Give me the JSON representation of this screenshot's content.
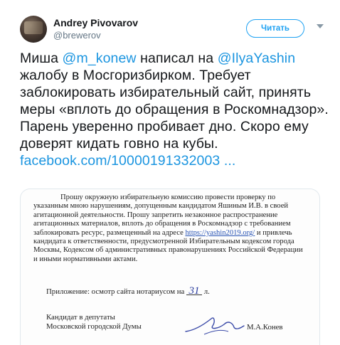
{
  "author": {
    "name": "Andrey Pivovarov",
    "handle": "@brewerov"
  },
  "follow_button": {
    "label": "Читать"
  },
  "tweet": {
    "text_1": "Миша ",
    "mention_1": "@m_konew",
    "text_2": " написал на ",
    "mention_2": "@IlyaYashin",
    "text_3": " жалобу в Мосгоризбирком. Требует заблокировать избирательный сайт, принять меры «вплоть до обращения в Роскомнадзор». Парень уверенно пробивает дно. Скоро ему доверят кидать говно на кубы.",
    "link": "facebook.com/10000191332003 ..."
  },
  "document": {
    "para_1": "Прошу окружную избирательную комиссию провести проверку по указанным мною нарушениям, допущенным кандидатом Яшиным И.В. в своей агитационной деятельности. Прошу запретить незаконное распространение агитационных материалов, вплоть до обращения в Роскомнадзор с требованием заблокировать ресурс, размещенный на адресе ",
    "url": "https://yashin2019.org/",
    "para_2": " и привлечь кандидата к ответственности, предусмотренной Избирательным кодексом города Москвы, Кодексом об административных правонарушениях Российской Федерации и иными нормативными актами.",
    "attachment_prefix": "Приложение: осмотр сайта нотариусом на ",
    "attachment_count": "31",
    "attachment_suffix": " л.",
    "candidate_line_1": "Кандидат в депутаты",
    "candidate_line_2": "Московской городской Думы",
    "signer": "М.А.Конев"
  },
  "colors": {
    "accent": "#1da1f2",
    "link": "#1b95e0",
    "muted": "#657786"
  },
  "icons": {
    "caret": "chevron-down-icon",
    "avatar": "avatar"
  }
}
